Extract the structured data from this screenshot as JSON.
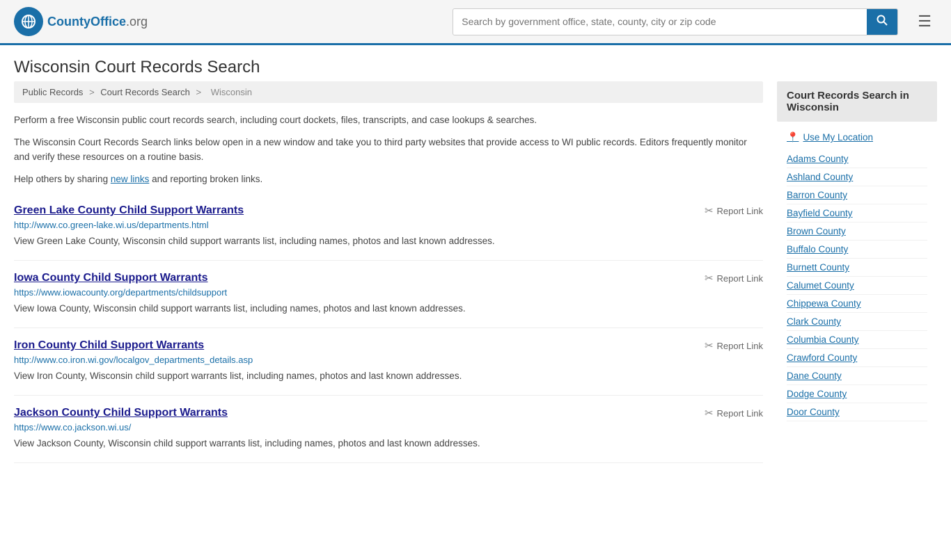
{
  "header": {
    "logo_text": "CountyOffice",
    "logo_suffix": ".org",
    "search_placeholder": "Search by government office, state, county, city or zip code",
    "menu_icon": "☰"
  },
  "page": {
    "title": "Wisconsin Court Records Search"
  },
  "breadcrumb": {
    "items": [
      "Public Records",
      "Court Records Search",
      "Wisconsin"
    ]
  },
  "intro": {
    "para1": "Perform a free Wisconsin public court records search, including court dockets, files, transcripts, and case lookups & searches.",
    "para2": "The Wisconsin Court Records Search links below open in a new window and take you to third party websites that provide access to WI public records. Editors frequently monitor and verify these resources on a routine basis.",
    "para3_prefix": "Help others by sharing ",
    "para3_link": "new links",
    "para3_suffix": " and reporting broken links."
  },
  "results": [
    {
      "title": "Green Lake County Child Support Warrants",
      "url": "http://www.co.green-lake.wi.us/departments.html",
      "description": "View Green Lake County, Wisconsin child support warrants list, including names, photos and last known addresses.",
      "report_label": "Report Link"
    },
    {
      "title": "Iowa County Child Support Warrants",
      "url": "https://www.iowacounty.org/departments/childsupport",
      "description": "View Iowa County, Wisconsin child support warrants list, including names, photos and last known addresses.",
      "report_label": "Report Link"
    },
    {
      "title": "Iron County Child Support Warrants",
      "url": "http://www.co.iron.wi.gov/localgov_departments_details.asp",
      "description": "View Iron County, Wisconsin child support warrants list, including names, photos and last known addresses.",
      "report_label": "Report Link"
    },
    {
      "title": "Jackson County Child Support Warrants",
      "url": "https://www.co.jackson.wi.us/",
      "description": "View Jackson County, Wisconsin child support warrants list, including names, photos and last known addresses.",
      "report_label": "Report Link"
    }
  ],
  "sidebar": {
    "title": "Court Records Search in Wisconsin",
    "use_location_label": "Use My Location",
    "counties": [
      "Adams County",
      "Ashland County",
      "Barron County",
      "Bayfield County",
      "Brown County",
      "Buffalo County",
      "Burnett County",
      "Calumet County",
      "Chippewa County",
      "Clark County",
      "Columbia County",
      "Crawford County",
      "Dane County",
      "Dodge County",
      "Door County"
    ]
  }
}
